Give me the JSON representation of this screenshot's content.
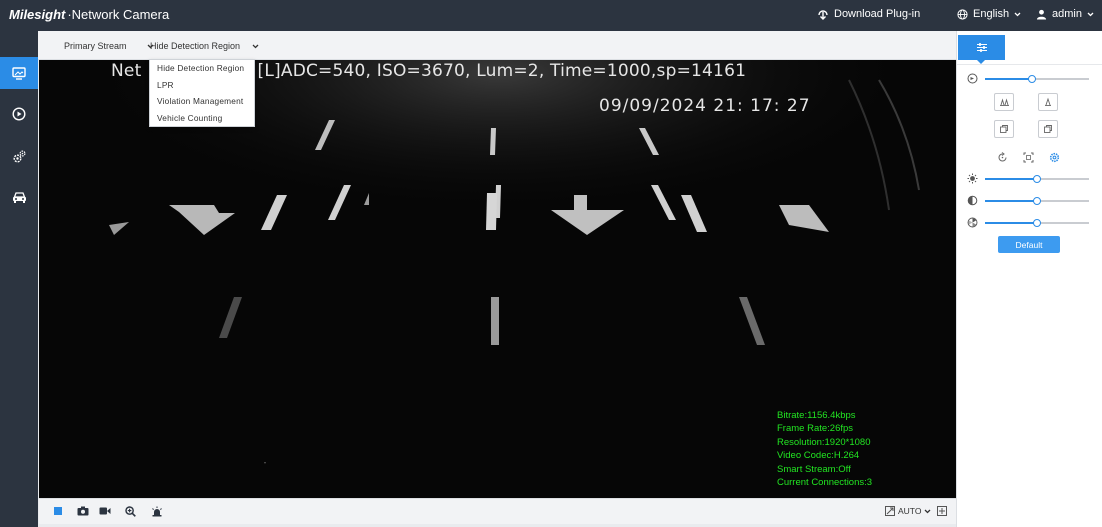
{
  "header": {
    "logo_brand": "Milesight",
    "logo_product": "·Network Camera",
    "download_plugin": "Download Plug-in",
    "language": "English",
    "user": "admin"
  },
  "sidebar": {
    "items": [
      {
        "name": "live-view",
        "icon": "monitor-icon",
        "active": true
      },
      {
        "name": "playback",
        "icon": "play-circle-icon",
        "active": false
      },
      {
        "name": "settings",
        "icon": "gears-icon",
        "active": false
      },
      {
        "name": "vehicle",
        "icon": "car-icon",
        "active": false
      }
    ]
  },
  "streambar": {
    "stream_label": "Primary Stream",
    "region_label": "Hide Detection Region"
  },
  "dropdown": {
    "items": [
      "Hide Detection Region",
      "LPR",
      "Violation Management",
      "Vehicle Counting"
    ]
  },
  "video": {
    "osd_line1": "Net",
    "osd_line1_rest": "era [L]ADC=540, ISO=3670, Lum=2, Time=1000,sp=14161",
    "osd_datetime": "09/09/2024  21: 17: 27",
    "stats": {
      "bitrate": "Bitrate:1156.4kbps",
      "frame_rate": "Frame Rate:26fps",
      "resolution": "Resolution:1920*1080",
      "codec": "Video Codec:H.264",
      "smart_stream": "Smart Stream:Off",
      "connections": "Current Connections:3"
    }
  },
  "bottombar": {
    "zoom_mode": "AUTO"
  },
  "panel": {
    "default_button": "Default",
    "sliders": {
      "zoom": 0.45,
      "brightness": 0.5,
      "contrast": 0.5,
      "saturation": 0.5
    }
  },
  "colors": {
    "accent": "#2b8ce6",
    "header_bg": "#2c3440",
    "stats_text": "#22e522"
  }
}
